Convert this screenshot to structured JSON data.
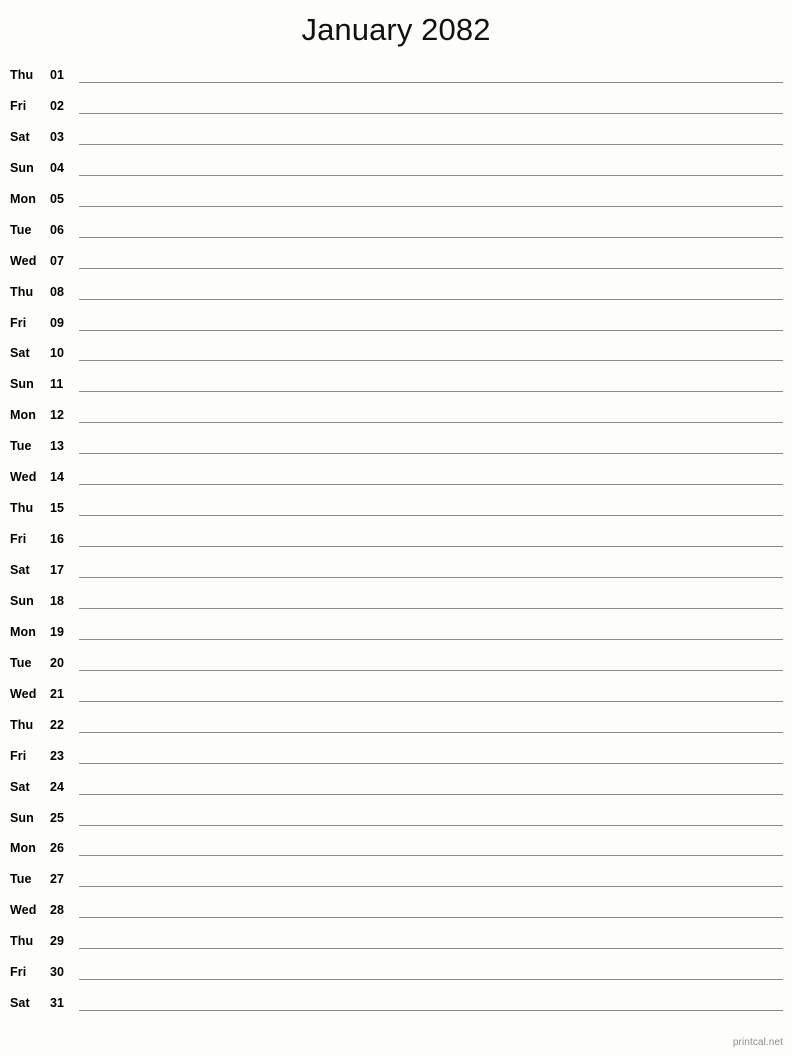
{
  "document": {
    "type": "printable-monthly-calendar",
    "title": "January 2082",
    "month": "January",
    "year": "2082",
    "background_color": "#fdfdfa",
    "rule_line_color": "#8a8e88",
    "text_color": "#000000"
  },
  "footer": {
    "attribution": "printcal.net",
    "color": "#8d8d8d"
  },
  "days": [
    {
      "dow": "Thu",
      "num": "01"
    },
    {
      "dow": "Fri",
      "num": "02"
    },
    {
      "dow": "Sat",
      "num": "03"
    },
    {
      "dow": "Sun",
      "num": "04"
    },
    {
      "dow": "Mon",
      "num": "05"
    },
    {
      "dow": "Tue",
      "num": "06"
    },
    {
      "dow": "Wed",
      "num": "07"
    },
    {
      "dow": "Thu",
      "num": "08"
    },
    {
      "dow": "Fri",
      "num": "09"
    },
    {
      "dow": "Sat",
      "num": "10"
    },
    {
      "dow": "Sun",
      "num": "11"
    },
    {
      "dow": "Mon",
      "num": "12"
    },
    {
      "dow": "Tue",
      "num": "13"
    },
    {
      "dow": "Wed",
      "num": "14"
    },
    {
      "dow": "Thu",
      "num": "15"
    },
    {
      "dow": "Fri",
      "num": "16"
    },
    {
      "dow": "Sat",
      "num": "17"
    },
    {
      "dow": "Sun",
      "num": "18"
    },
    {
      "dow": "Mon",
      "num": "19"
    },
    {
      "dow": "Tue",
      "num": "20"
    },
    {
      "dow": "Wed",
      "num": "21"
    },
    {
      "dow": "Thu",
      "num": "22"
    },
    {
      "dow": "Fri",
      "num": "23"
    },
    {
      "dow": "Sat",
      "num": "24"
    },
    {
      "dow": "Sun",
      "num": "25"
    },
    {
      "dow": "Mon",
      "num": "26"
    },
    {
      "dow": "Tue",
      "num": "27"
    },
    {
      "dow": "Wed",
      "num": "28"
    },
    {
      "dow": "Thu",
      "num": "29"
    },
    {
      "dow": "Fri",
      "num": "30"
    },
    {
      "dow": "Sat",
      "num": "31"
    }
  ]
}
